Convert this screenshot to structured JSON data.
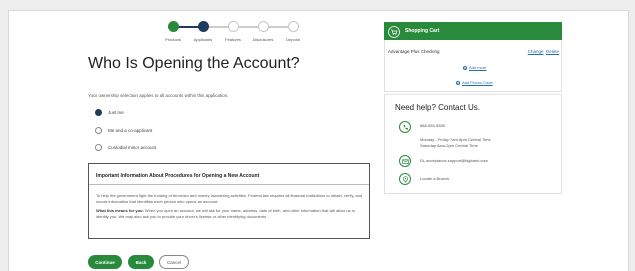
{
  "progress": {
    "steps": [
      {
        "label": "Products",
        "state": "done"
      },
      {
        "label": "Applicants",
        "state": "current"
      },
      {
        "label": "Features",
        "state": "todo"
      },
      {
        "label": "Disclosures",
        "state": "todo"
      },
      {
        "label": "Deposit",
        "state": "todo"
      }
    ]
  },
  "page": {
    "title": "Who Is Opening the Account?",
    "intro": "Your ownership selection applies to all accounts within this application."
  },
  "options": [
    {
      "label": "Just me",
      "selected": true
    },
    {
      "label": "Me and a co-applicant",
      "selected": false
    },
    {
      "label": "Custodial minor account",
      "selected": false
    }
  ],
  "info": {
    "title": "Important Information About Procedures for Opening a New Account",
    "paragraph1": "To help the government fight the funding of terrorism and money laundering activities, Federal law requires all financial institutions to obtain, verify, and record information that identifies each person who opens an account.",
    "paragraph2_lead": "What this means for you:",
    "paragraph2_body": " When you open an account, we will ask for your name, address, date of birth, and other information that will allow us to identify you. We may also ask you to provide your driver's license or other identifying documents."
  },
  "buttons": {
    "continue": "Continue",
    "back": "Back",
    "cancel": "Cancel"
  },
  "cart": {
    "title": "Shopping Cart",
    "product": "Advantage Plus Checking",
    "change": "Change",
    "delete": "Delete",
    "add_more": "Add more",
    "add_promo": "Add Promo Code"
  },
  "help": {
    "title": "Need help? Contact Us.",
    "phone": "888-555-5555",
    "hours1": "Monday - Friday 7am-8pm Central Time",
    "hours2": "Saturday 8am-2pm Central Time",
    "email": "DL.acceptance.support@bigbank.com",
    "branch": "Locate a Branch"
  },
  "colors": {
    "brand_green": "#2a8a3c",
    "nav_blue": "#1e3a5f",
    "link_blue": "#1f6fb2"
  }
}
